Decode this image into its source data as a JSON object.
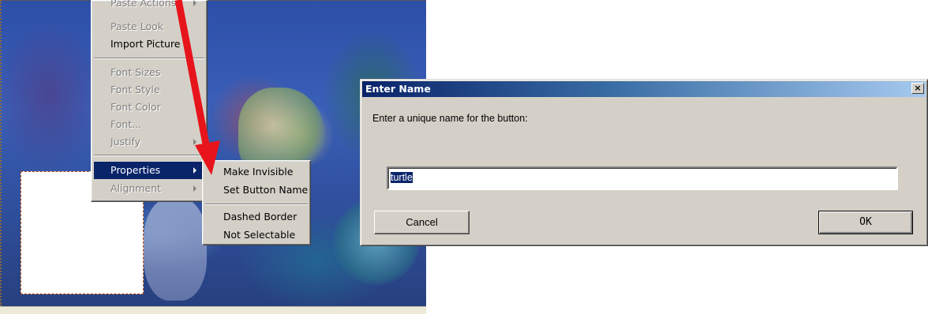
{
  "context_menu": {
    "items": [
      {
        "label": "Paste Actions",
        "disabled": true,
        "submenu": true
      },
      {
        "label": "Paste Look",
        "disabled": true,
        "submenu": false
      },
      {
        "label": "Import Picture",
        "disabled": false,
        "submenu": false
      },
      {
        "label": "Font Sizes",
        "disabled": true,
        "submenu": true
      },
      {
        "label": "Font Style",
        "disabled": true,
        "submenu": true
      },
      {
        "label": "Font Color",
        "disabled": true,
        "submenu": false
      },
      {
        "label": "Font...",
        "disabled": true,
        "submenu": false
      },
      {
        "label": "Justify",
        "disabled": true,
        "submenu": true
      },
      {
        "label": "Properties",
        "disabled": false,
        "submenu": true,
        "highlighted": true
      },
      {
        "label": "Alignment",
        "disabled": true,
        "submenu": true
      }
    ]
  },
  "properties_submenu": {
    "items": [
      {
        "label": "Make Invisible"
      },
      {
        "label": "Set Button Name"
      },
      {
        "label": "Dashed Border"
      },
      {
        "label": "Not Selectable"
      }
    ]
  },
  "dialog": {
    "title": "Enter Name",
    "close_glyph": "×",
    "prompt": "Enter a unique name for the button:",
    "input_value": "turtle",
    "cancel_label": "Cancel",
    "ok_label": "OK"
  },
  "colors": {
    "annotation_arrow": "#e8141b",
    "menu_highlight": "#0a246a",
    "title_bar_start": "#0a246a",
    "title_bar_end": "#a6caf0"
  }
}
